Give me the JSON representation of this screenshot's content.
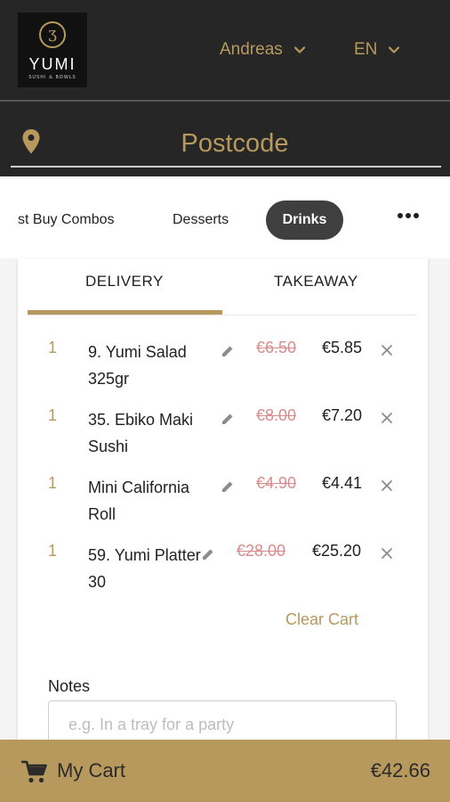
{
  "brand": {
    "logo_mark": "ʒ",
    "name": "YUMI",
    "tagline": "SUSHI & BOWLS"
  },
  "header": {
    "user_name": "Andreas",
    "language": "EN"
  },
  "location": {
    "postcode_placeholder": "Postcode"
  },
  "categories": {
    "items": [
      "st Buy Combos",
      "Desserts",
      "Drinks"
    ],
    "selected": "Drinks"
  },
  "order_type": {
    "tabs": [
      "DELIVERY",
      "TAKEAWAY"
    ],
    "selected": "DELIVERY"
  },
  "cart": {
    "items": [
      {
        "qty": "1",
        "name": "9. Yumi Salad 325gr",
        "old_price": "€6.50",
        "price": "€5.85"
      },
      {
        "qty": "1",
        "name": "35. Ebiko Maki Sushi",
        "old_price": "€8.00",
        "price": "€7.20"
      },
      {
        "qty": "1",
        "name": "Mini California Roll",
        "old_price": "€4.90",
        "price": "€4.41"
      },
      {
        "qty": "1",
        "name": "59. Yumi Platter 30",
        "old_price": "€28.00",
        "price": "€25.20"
      }
    ],
    "clear_label": "Clear Cart",
    "notes_label": "Notes",
    "notes_placeholder": "e.g. In a tray for a party"
  },
  "footer": {
    "cart_label": "My Cart",
    "total": "€42.66"
  },
  "colors": {
    "accent_gold": "#b7995e",
    "dark_bg": "#262626",
    "strike_red": "#d98b8b",
    "pill_dark": "#3f3f3f"
  },
  "icons": {
    "dropdown": "chevron-down-icon",
    "location": "map-pin-icon",
    "more": "more-horizontal-icon",
    "edit": "pencil-icon",
    "remove": "close-icon",
    "cart": "shopping-cart-icon"
  }
}
